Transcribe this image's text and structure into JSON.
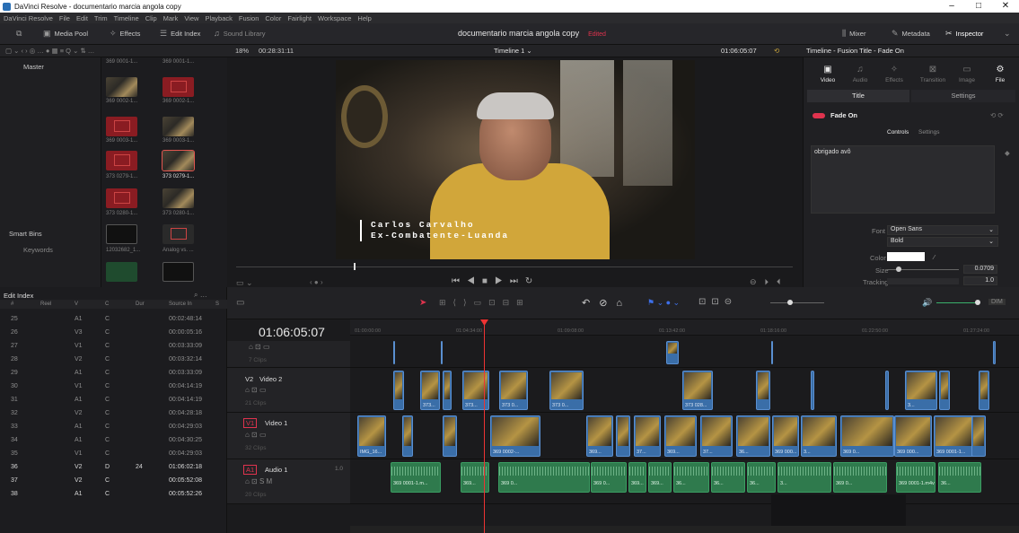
{
  "window": {
    "title": "DaVinci Resolve - documentario marcia angola copy"
  },
  "menu": [
    "DaVinci Resolve",
    "File",
    "Edit",
    "Trim",
    "Timeline",
    "Clip",
    "Mark",
    "View",
    "Playback",
    "Fusion",
    "Color",
    "Fairlight",
    "Workspace",
    "Help"
  ],
  "toolbar": {
    "media_pool": "Media Pool",
    "effects": "Effects",
    "edit_index": "Edit Index",
    "sound_library": "Sound Library",
    "project_title": "documentario marcia angola copy",
    "edited": "Edited",
    "mixer": "Mixer",
    "metadata": "Metadata",
    "inspector": "Inspector"
  },
  "subbar": {
    "zoom": "18%",
    "source_tc": "00:28:31:11",
    "timeline_name": "Timeline 1",
    "record_tc": "01:06:05:07",
    "inspector_title": "Timeline - Fusion Title - Fade On"
  },
  "bins": {
    "master": "Master",
    "smart_bins": "Smart Bins",
    "keywords": "Keywords"
  },
  "media_clips": [
    {
      "label": "369 0001-1..."
    },
    {
      "label": "369 0001-1..."
    },
    {
      "label": "369 0002-1..."
    },
    {
      "label": "369 0002-1..."
    },
    {
      "label": "369 0003-1..."
    },
    {
      "label": "369 0003-1..."
    },
    {
      "label": "373 0279-1..."
    },
    {
      "label": "373 0279-1..."
    },
    {
      "label": "373 0280-1..."
    },
    {
      "label": "373 0280-1..."
    },
    {
      "label": "12032682_1..."
    },
    {
      "label": "Analog vs. ..."
    }
  ],
  "viewer": {
    "line1": "Carlos Carvalho",
    "line2": "Ex-Combatente-Luanda"
  },
  "inspector": {
    "tabs": [
      "Video",
      "Audio",
      "Effects",
      "Transition",
      "Image",
      "File"
    ],
    "subtabs": [
      "Title",
      "Settings"
    ],
    "effect": "Fade On",
    "controls_tabs": [
      "Controls",
      "Settings"
    ],
    "text": "obrigado avô",
    "font_label": "Font",
    "font": "Open Sans",
    "style": "Bold",
    "color_label": "Color",
    "size_label": "Size",
    "size": "0.0709",
    "tracking_label": "Tracking",
    "tracking": "1.0"
  },
  "edit_index": {
    "title": "Edit Index",
    "columns": [
      "#",
      "Reel",
      "V",
      "C",
      "Dur",
      "Source In",
      "S"
    ],
    "rows": [
      {
        "n": "25",
        "v": "A1",
        "c": "C",
        "dur": "",
        "src": "00:02:48:14"
      },
      {
        "n": "26",
        "v": "V3",
        "c": "C",
        "dur": "",
        "src": "00:00:05:16"
      },
      {
        "n": "27",
        "v": "V1",
        "c": "C",
        "dur": "",
        "src": "00:03:33:09"
      },
      {
        "n": "28",
        "v": "V2",
        "c": "C",
        "dur": "",
        "src": "00:03:32:14"
      },
      {
        "n": "29",
        "v": "A1",
        "c": "C",
        "dur": "",
        "src": "00:03:33:09"
      },
      {
        "n": "30",
        "v": "V1",
        "c": "C",
        "dur": "",
        "src": "00:04:14:19"
      },
      {
        "n": "31",
        "v": "A1",
        "c": "C",
        "dur": "",
        "src": "00:04:14:19"
      },
      {
        "n": "32",
        "v": "V2",
        "c": "C",
        "dur": "",
        "src": "00:04:28:18"
      },
      {
        "n": "33",
        "v": "A1",
        "c": "C",
        "dur": "",
        "src": "00:04:29:03"
      },
      {
        "n": "34",
        "v": "A1",
        "c": "C",
        "dur": "",
        "src": "00:04:30:25"
      },
      {
        "n": "35",
        "v": "V1",
        "c": "C",
        "dur": "",
        "src": "00:04:29:03"
      },
      {
        "n": "36",
        "v": "V2",
        "c": "D",
        "dur": "24",
        "src": "01:06:02:18"
      },
      {
        "n": "37",
        "v": "V2",
        "c": "C",
        "dur": "",
        "src": "00:05:52:08"
      },
      {
        "n": "38",
        "v": "A1",
        "c": "C",
        "dur": "",
        "src": "00:05:52:26"
      }
    ]
  },
  "timeline": {
    "timecode": "01:06:05:07",
    "ruler": [
      "01:00:00:00",
      "01:04:34:00",
      "01:09:08:00",
      "01:13:42:00",
      "01:18:16:00",
      "01:22:50:00",
      "01:27:24:00"
    ],
    "tracks": [
      {
        "id": "V3",
        "name": "",
        "clips": "7 Clips"
      },
      {
        "id": "V2",
        "name": "Video 2",
        "clips": "21 Clips"
      },
      {
        "id": "V1",
        "name": "Video 1",
        "clips": "32 Clips"
      },
      {
        "id": "A1",
        "name": "Audio 1",
        "level": "1.0",
        "clips": "20 Clips"
      }
    ],
    "v2_labels": [
      "373...",
      "373...",
      "373 0...",
      "373 0...",
      "373 028...",
      "3...",
      "373 027...",
      "37..."
    ],
    "v1_labels": [
      "IMG_16...",
      "369 0002-...",
      "369...",
      "37...",
      "369...",
      "37...",
      "36...",
      "369 000...",
      "3...",
      "369 0...",
      "369 000...",
      "369 0001-1...",
      "369 000..."
    ],
    "a1_labels": [
      "369 0001-1.m...",
      "369...",
      "369 0...",
      "369 0...",
      "369...",
      "369...",
      "36...",
      "36...",
      "36...",
      "3...",
      "369 0...",
      "369 0001-1.m4v",
      "36...",
      "369 000..."
    ]
  }
}
